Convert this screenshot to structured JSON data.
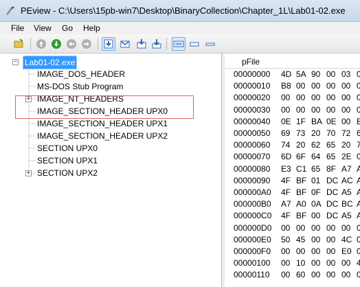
{
  "window": {
    "title": "PEview - C:\\Users\\15pb-win7\\Desktop\\BinaryCollection\\Chapter_1L\\Lab01-02.exe"
  },
  "menu": [
    "File",
    "View",
    "Go",
    "Help"
  ],
  "toolbar_icons": [
    "open-icon",
    "up-icon",
    "forward-green-icon",
    "back-icon",
    "forward-icon",
    "view-down-icon",
    "view-envelope-icon",
    "view-down-arrow-icon",
    "view-down-arrow-alt-icon",
    "view-list-icon",
    "view-small-icon",
    "view-minimal-icon"
  ],
  "tree": {
    "root": "Lab01-02.exe",
    "items": [
      "IMAGE_DOS_HEADER",
      "MS-DOS Stub Program",
      "IMAGE_NT_HEADERS",
      "IMAGE_SECTION_HEADER UPX0",
      "IMAGE_SECTION_HEADER UPX1",
      "IMAGE_SECTION_HEADER UPX2",
      "SECTION UPX0",
      "SECTION UPX1",
      "SECTION UPX2"
    ]
  },
  "hex": {
    "column_header": "pFile",
    "rows": [
      {
        "offset": "00000000",
        "bytes": [
          "4D",
          "5A",
          "90",
          "00",
          "03",
          "0"
        ]
      },
      {
        "offset": "00000010",
        "bytes": [
          "B8",
          "00",
          "00",
          "00",
          "00",
          "0"
        ]
      },
      {
        "offset": "00000020",
        "bytes": [
          "00",
          "00",
          "00",
          "00",
          "00",
          "0"
        ]
      },
      {
        "offset": "00000030",
        "bytes": [
          "00",
          "00",
          "00",
          "00",
          "00",
          "0"
        ]
      },
      {
        "offset": "00000040",
        "bytes": [
          "0E",
          "1F",
          "BA",
          "0E",
          "00",
          "B"
        ]
      },
      {
        "offset": "00000050",
        "bytes": [
          "69",
          "73",
          "20",
          "70",
          "72",
          "6"
        ]
      },
      {
        "offset": "00000060",
        "bytes": [
          "74",
          "20",
          "62",
          "65",
          "20",
          "7"
        ]
      },
      {
        "offset": "00000070",
        "bytes": [
          "6D",
          "6F",
          "64",
          "65",
          "2E",
          "0"
        ]
      },
      {
        "offset": "00000080",
        "bytes": [
          "E3",
          "C1",
          "65",
          "8F",
          "A7",
          "A"
        ]
      },
      {
        "offset": "00000090",
        "bytes": [
          "4F",
          "BF",
          "01",
          "DC",
          "AC",
          "A"
        ]
      },
      {
        "offset": "000000A0",
        "bytes": [
          "4F",
          "BF",
          "0F",
          "DC",
          "A5",
          "A"
        ]
      },
      {
        "offset": "000000B0",
        "bytes": [
          "A7",
          "A0",
          "0A",
          "DC",
          "BC",
          "A"
        ]
      },
      {
        "offset": "000000C0",
        "bytes": [
          "4F",
          "BF",
          "00",
          "DC",
          "A5",
          "A"
        ]
      },
      {
        "offset": "000000D0",
        "bytes": [
          "00",
          "00",
          "00",
          "00",
          "00",
          "0"
        ]
      },
      {
        "offset": "000000E0",
        "bytes": [
          "50",
          "45",
          "00",
          "00",
          "4C",
          "0"
        ]
      },
      {
        "offset": "000000F0",
        "bytes": [
          "00",
          "00",
          "00",
          "00",
          "E0",
          "0"
        ]
      },
      {
        "offset": "00000100",
        "bytes": [
          "00",
          "10",
          "00",
          "00",
          "00",
          "4"
        ]
      },
      {
        "offset": "00000110",
        "bytes": [
          "00",
          "60",
          "00",
          "00",
          "00",
          "0"
        ]
      }
    ]
  }
}
